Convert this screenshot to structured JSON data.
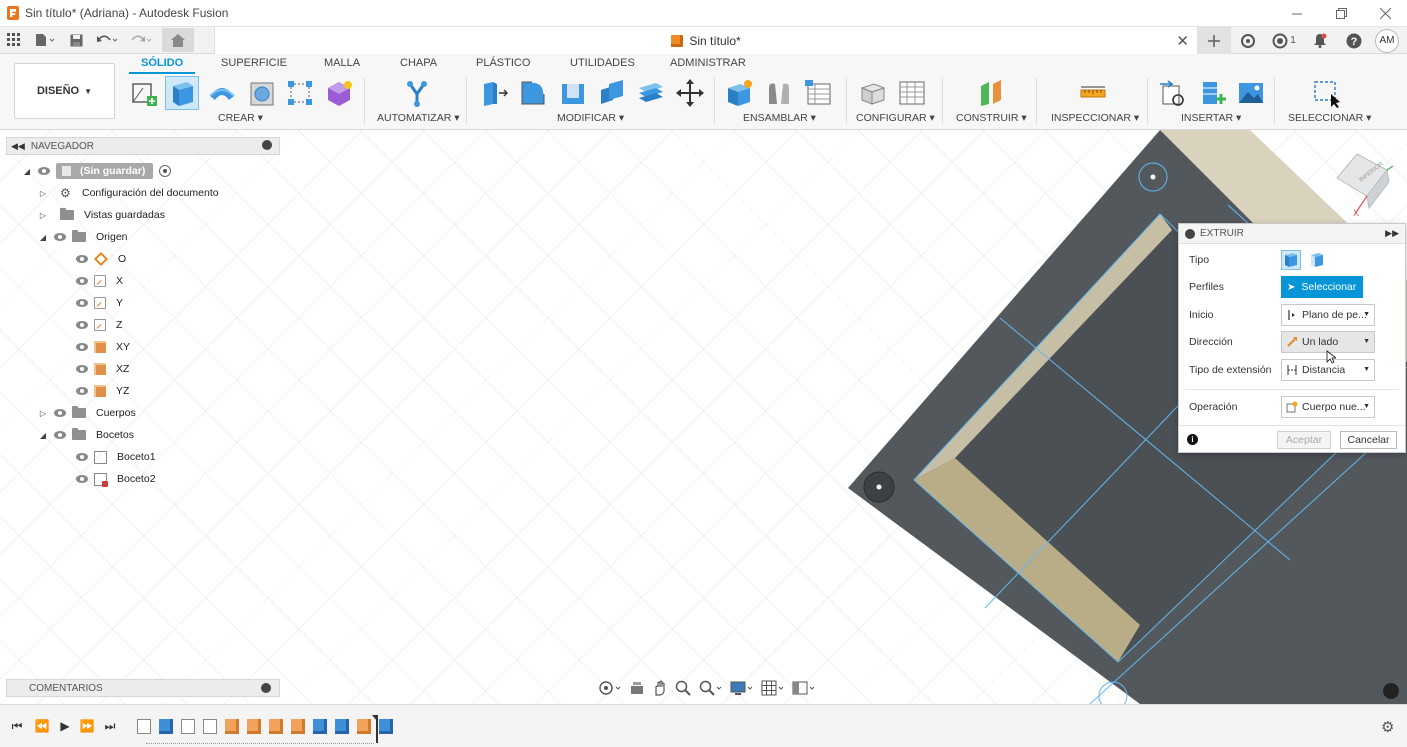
{
  "window": {
    "title": "Sin título* (Adriana) - Autodesk Fusion",
    "restore_icon": "restore-icon",
    "close_icon": "close-icon"
  },
  "quick_access": {
    "grid_icon": "app-grid-icon",
    "file_icon": "file-icon",
    "save_icon": "save-icon",
    "undo_icon": "undo-icon",
    "redo_icon": "redo-icon",
    "home_icon": "home-icon"
  },
  "document_tab": {
    "label": "Sin título*",
    "close": "✕"
  },
  "top_right": {
    "jobs_count": "1",
    "avatar_initials": "AM"
  },
  "ribbon": {
    "workspace": "DISEÑO",
    "tabs": [
      "SÓLIDO",
      "SUPERFICIE",
      "MALLA",
      "CHAPA",
      "PLÁSTICO",
      "UTILIDADES",
      "ADMINISTRAR"
    ],
    "active_tab": "SÓLIDO",
    "groups": {
      "crear": "CREAR ▾",
      "automatizar": "AUTOMATIZAR ▾",
      "modificar": "MODIFICAR ▾",
      "ensamblar": "ENSAMBLAR ▾",
      "configurar": "CONFIGURAR ▾",
      "construir": "CONSTRUIR ▾",
      "inspeccionar": "INSPECCIONAR ▾",
      "insertar": "INSERTAR ▾",
      "seleccionar": "SELECCIONAR ▾"
    },
    "accent_color": "#0696d7"
  },
  "browser": {
    "title": "NAVEGADOR",
    "root": "(Sin guardar)",
    "items": {
      "doc_settings": "Configuración del documento",
      "named_views": "Vistas guardadas",
      "origin": "Origen",
      "origin_point": "O",
      "axis_x": "X",
      "axis_y": "Y",
      "axis_z": "Z",
      "plane_xy": "XY",
      "plane_xz": "XZ",
      "plane_yz": "YZ",
      "bodies": "Cuerpos",
      "sketches": "Bocetos",
      "sketch1": "Boceto1",
      "sketch2": "Boceto2"
    }
  },
  "comments": {
    "title": "COMENTARIOS"
  },
  "extrude_dialog": {
    "title": "EXTRUIR",
    "rows": {
      "type_label": "Tipo",
      "profiles_label": "Perfiles",
      "profiles_button": "Seleccionar",
      "start_label": "Inicio",
      "start_value": "Plano de pe...",
      "direction_label": "Dirección",
      "direction_value": "Un lado",
      "extent_label": "Tipo de extensión",
      "extent_value": "Distancia",
      "operation_label": "Operación",
      "operation_value": "Cuerpo nue..."
    },
    "ok_button": "Aceptar",
    "cancel_button": "Cancelar"
  },
  "viewcube": {
    "face_label": "INFERIOR"
  },
  "timeline": {
    "features": [
      "sketch",
      "extrude",
      "sketch",
      "sketch",
      "orange",
      "orange",
      "orange",
      "orange",
      "extrude",
      "extrude",
      "orange",
      "extrude"
    ]
  }
}
